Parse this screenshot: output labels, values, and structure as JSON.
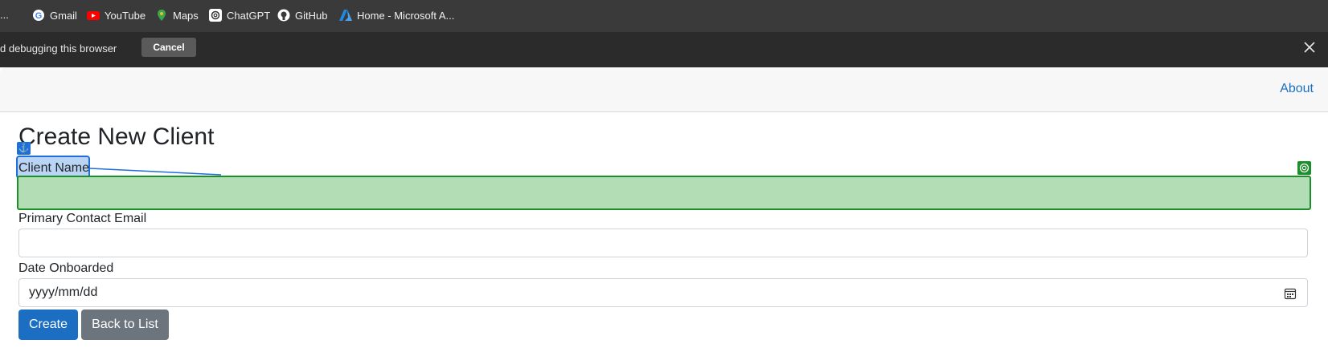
{
  "bookmarks": [
    {
      "label": "...",
      "icon": "truncated-item"
    },
    {
      "label": "Gmail",
      "icon": "google-icon"
    },
    {
      "label": "YouTube",
      "icon": "youtube-icon"
    },
    {
      "label": "Maps",
      "icon": "maps-pin-icon"
    },
    {
      "label": "ChatGPT",
      "icon": "chatgpt-icon"
    },
    {
      "label": "GitHub",
      "icon": "github-icon"
    },
    {
      "label": "Home - Microsoft A...",
      "icon": "azure-icon"
    }
  ],
  "debug_banner": {
    "text": "d debugging this browser",
    "cancel_label": "Cancel"
  },
  "navbar": {
    "about_label": "About"
  },
  "form": {
    "title": "Create New Client",
    "client_name_label": "Client Name",
    "client_name_value": "",
    "email_label": "Primary Contact Email",
    "email_value": "",
    "date_label": "Date Onboarded",
    "date_placeholder": "yyyy/mm/dd",
    "create_label": "Create",
    "back_label": "Back to List"
  },
  "colors": {
    "primary": "#1b6ec2",
    "secondary": "#6c757d",
    "highlight_green": "#1b8f2a",
    "highlight_blue": "#1e6fd9"
  }
}
